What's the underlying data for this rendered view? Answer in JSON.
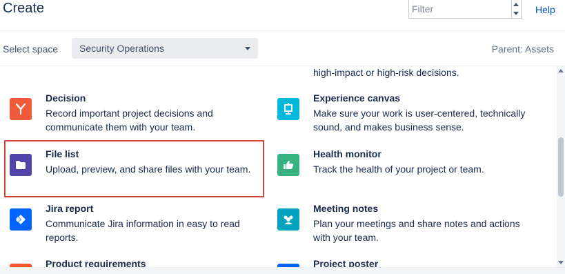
{
  "header": {
    "title": "Create",
    "filter_placeholder": "Filter",
    "help_label": "Help"
  },
  "space": {
    "label": "Select space",
    "selected": "Security Operations",
    "parent": "Parent: Assets"
  },
  "templates": {
    "partial_top_desc": "high-impact or high-risk decisions.",
    "items": [
      {
        "name": "Decision",
        "desc": "Record important project decisions and communicate them with your team.",
        "icon": "decision-icon",
        "color": "#f15a3a"
      },
      {
        "name": "Experience canvas",
        "desc": "Make sure your work is user-centered, technically sound, and makes business sense.",
        "icon": "experience-canvas-icon",
        "color": "#00b8d9"
      },
      {
        "name": "File list",
        "desc": "Upload, preview, and share files with your team.",
        "icon": "folder-icon",
        "color": "#5243aa"
      },
      {
        "name": "Health monitor",
        "desc": "Track the health of your project or team.",
        "icon": "thumbs-up-icon",
        "color": "#36b37e"
      },
      {
        "name": "Jira report",
        "desc": "Communicate Jira information in easy to read reports.",
        "icon": "jira-icon",
        "color": "#0065ff"
      },
      {
        "name": "Meeting notes",
        "desc": "Plan your meetings and share notes and actions with your team.",
        "icon": "people-icon",
        "color": "#00a3bf"
      },
      {
        "name": "Product requirements",
        "desc": "",
        "icon": "product-requirements-icon",
        "color": "#ff5630"
      },
      {
        "name": "Project poster",
        "desc": "",
        "icon": "project-poster-icon",
        "color": "#0065ff"
      }
    ]
  }
}
